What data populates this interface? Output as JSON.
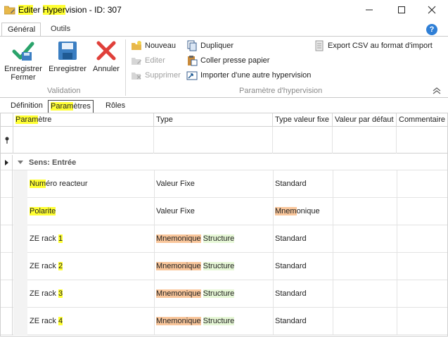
{
  "window": {
    "title_parts": [
      "Editer",
      " ",
      "Hypervision",
      " - ID: 307"
    ],
    "title_highlights": [
      "Edit",
      "Hyper"
    ]
  },
  "ribbon": {
    "tabs": [
      "Général",
      "Outils"
    ],
    "validation": {
      "label": "Validation",
      "save_close": [
        "Enregistrer",
        "Fermer"
      ],
      "save": "Enregistrer",
      "cancel": "Annuler"
    },
    "parametre": {
      "label": "Paramètre d'hypervision",
      "nouveau": "Nouveau",
      "editer": "Editer",
      "supprimer": "Supprimer",
      "dupliquer": "Dupliquer",
      "coller": "Coller presse papier",
      "importer": "Importer d'une autre hypervision",
      "export": "Export CSV au format d'import"
    }
  },
  "page_tabs": [
    "Définition",
    "Paramètres",
    "Rôles"
  ],
  "grid": {
    "columns": [
      "Paramètre",
      "Type",
      "Type valeur fixe",
      "Valeur par défaut",
      "Commentaire"
    ],
    "group": "Sens: Entrée",
    "rows": [
      {
        "parametre": "Numéro reacteur",
        "type": "Valeur Fixe",
        "type_valeur_fixe": "Standard",
        "valeur_defaut": "",
        "commentaire": ""
      },
      {
        "parametre": "Polarite",
        "type": "Valeur Fixe",
        "type_valeur_fixe": "Mnemonique",
        "valeur_defaut": "",
        "commentaire": ""
      },
      {
        "parametre": "ZE rack 1",
        "type": "Mnemonique Structure",
        "type_valeur_fixe": "Standard",
        "valeur_defaut": "",
        "commentaire": ""
      },
      {
        "parametre": "ZE rack 2",
        "type": "Mnemonique Structure",
        "type_valeur_fixe": "Standard",
        "valeur_defaut": "",
        "commentaire": ""
      },
      {
        "parametre": "ZE rack 3",
        "type": "Mnemonique Structure",
        "type_valeur_fixe": "Standard",
        "valeur_defaut": "",
        "commentaire": ""
      },
      {
        "parametre": "ZE rack 4",
        "type": "Mnemonique Structure",
        "type_valeur_fixe": "Standard",
        "valeur_defaut": "",
        "commentaire": ""
      }
    ]
  },
  "colors": {
    "highlight_yellow": "#ffff33",
    "highlight_orange": "#f9c69b",
    "highlight_green": "#e6f7d6",
    "accent_blue": "#2f7fd6"
  }
}
